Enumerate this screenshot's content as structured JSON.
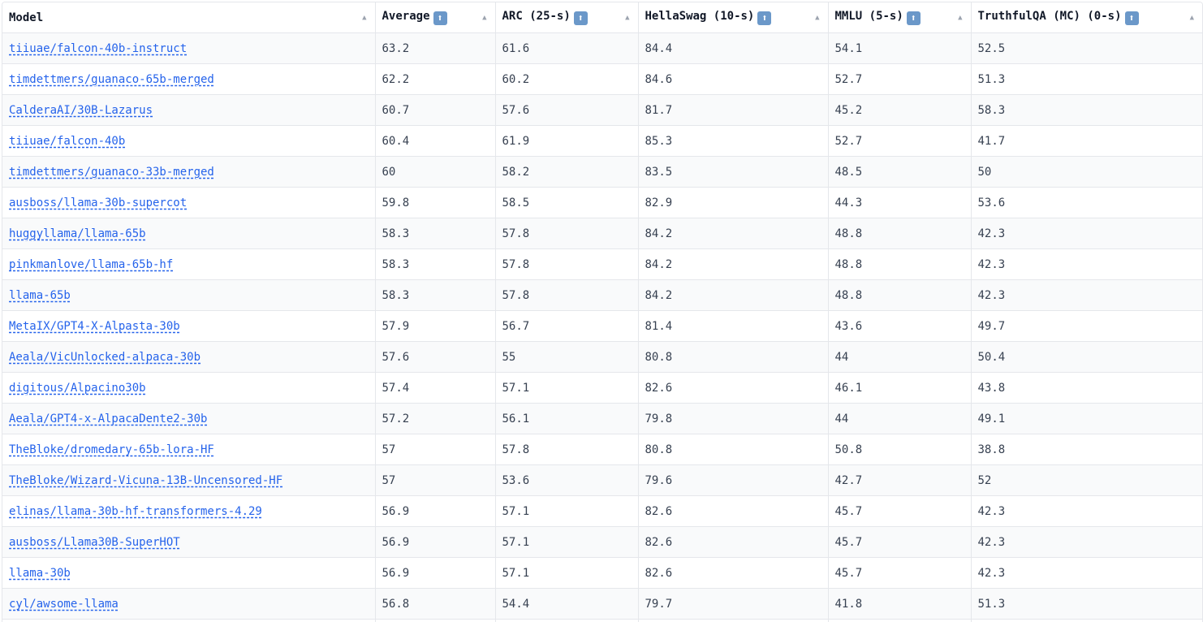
{
  "table": {
    "headers": [
      {
        "label": "Model",
        "emoji": ""
      },
      {
        "label": "Average",
        "emoji": "⬆"
      },
      {
        "label": "ARC (25-s)",
        "emoji": "⬆"
      },
      {
        "label": "HellaSwag (10-s)",
        "emoji": "⬆"
      },
      {
        "label": "MMLU (5-s)",
        "emoji": "⬆"
      },
      {
        "label": "TruthfulQA (MC) (0-s)",
        "emoji": "⬆"
      }
    ],
    "sort_glyph": "▲",
    "rows": [
      [
        "tiiuae/falcon-40b-instruct",
        "63.2",
        "61.6",
        "84.4",
        "54.1",
        "52.5"
      ],
      [
        "timdettmers/guanaco-65b-merged",
        "62.2",
        "60.2",
        "84.6",
        "52.7",
        "51.3"
      ],
      [
        "CalderaAI/30B-Lazarus",
        "60.7",
        "57.6",
        "81.7",
        "45.2",
        "58.3"
      ],
      [
        "tiiuae/falcon-40b",
        "60.4",
        "61.9",
        "85.3",
        "52.7",
        "41.7"
      ],
      [
        "timdettmers/guanaco-33b-merged",
        "60",
        "58.2",
        "83.5",
        "48.5",
        "50"
      ],
      [
        "ausboss/llama-30b-supercot",
        "59.8",
        "58.5",
        "82.9",
        "44.3",
        "53.6"
      ],
      [
        "huggyllama/llama-65b",
        "58.3",
        "57.8",
        "84.2",
        "48.8",
        "42.3"
      ],
      [
        "pinkmanlove/llama-65b-hf",
        "58.3",
        "57.8",
        "84.2",
        "48.8",
        "42.3"
      ],
      [
        "llama-65b",
        "58.3",
        "57.8",
        "84.2",
        "48.8",
        "42.3"
      ],
      [
        "MetaIX/GPT4-X-Alpasta-30b",
        "57.9",
        "56.7",
        "81.4",
        "43.6",
        "49.7"
      ],
      [
        "Aeala/VicUnlocked-alpaca-30b",
        "57.6",
        "55",
        "80.8",
        "44",
        "50.4"
      ],
      [
        "digitous/Alpacino30b",
        "57.4",
        "57.1",
        "82.6",
        "46.1",
        "43.8"
      ],
      [
        "Aeala/GPT4-x-AlpacaDente2-30b",
        "57.2",
        "56.1",
        "79.8",
        "44",
        "49.1"
      ],
      [
        "TheBloke/dromedary-65b-lora-HF",
        "57",
        "57.8",
        "80.8",
        "50.8",
        "38.8"
      ],
      [
        "TheBloke/Wizard-Vicuna-13B-Uncensored-HF",
        "57",
        "53.6",
        "79.6",
        "42.7",
        "52"
      ],
      [
        "elinas/llama-30b-hf-transformers-4.29",
        "56.9",
        "57.1",
        "82.6",
        "45.7",
        "42.3"
      ],
      [
        "ausboss/Llama30B-SuperHOT",
        "56.9",
        "57.1",
        "82.6",
        "45.7",
        "42.3"
      ],
      [
        "llama-30b",
        "56.9",
        "57.1",
        "82.6",
        "45.7",
        "42.3"
      ],
      [
        "cyl/awsome-llama",
        "56.8",
        "54.4",
        "79.7",
        "41.8",
        "51.3"
      ],
      [
        "",
        "",
        "",
        "",
        "",
        ""
      ]
    ]
  },
  "colors": {
    "link": "#2563eb",
    "stripe": "#f9fafb",
    "border": "#e5e7eb",
    "emoji_bg": "#6b98c9"
  },
  "icons": {
    "sort": "sort-ascending-icon",
    "header_emoji": "up-arrow-emoji-icon"
  }
}
